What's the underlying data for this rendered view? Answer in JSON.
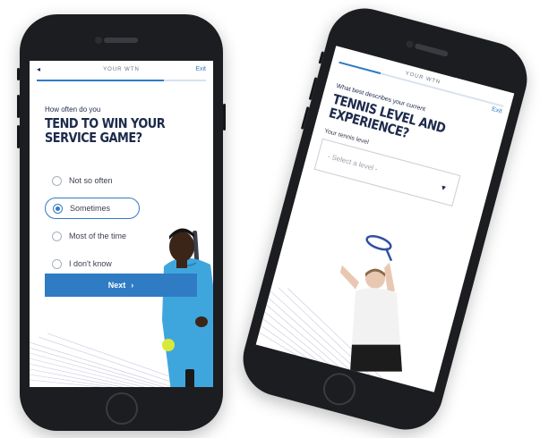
{
  "screen1": {
    "back_icon": "back-arrow-icon",
    "back_glyph": "◂",
    "title": "YOUR WTN",
    "exit": "Exit",
    "progress_fraction": 0.75,
    "question_pre": "How often do you",
    "question_main_line1": "TEND TO WIN YOUR",
    "question_main_line2": "SERVICE GAME?",
    "options": [
      {
        "label": "Not so often",
        "selected": false
      },
      {
        "label": "Sometimes",
        "selected": true
      },
      {
        "label": "Most of the time",
        "selected": false
      },
      {
        "label": "I don't know",
        "selected": false
      }
    ],
    "next_label": "Next",
    "next_glyph": "›",
    "accent_color": "#2f7bc4",
    "heading_color": "#1d2a4b"
  },
  "screen2": {
    "title": "YOUR WTN",
    "exit": "Exit",
    "progress_fraction": 0.25,
    "question_pre": "What best describes your current",
    "question_main_line1": "TENNIS LEVEL AND",
    "question_main_line2": "EXPERIENCE?",
    "field_label": "Your tennis level",
    "select_placeholder": "- Select a level -",
    "caret_glyph": "▼",
    "caret_icon": "chevron-down-icon"
  }
}
